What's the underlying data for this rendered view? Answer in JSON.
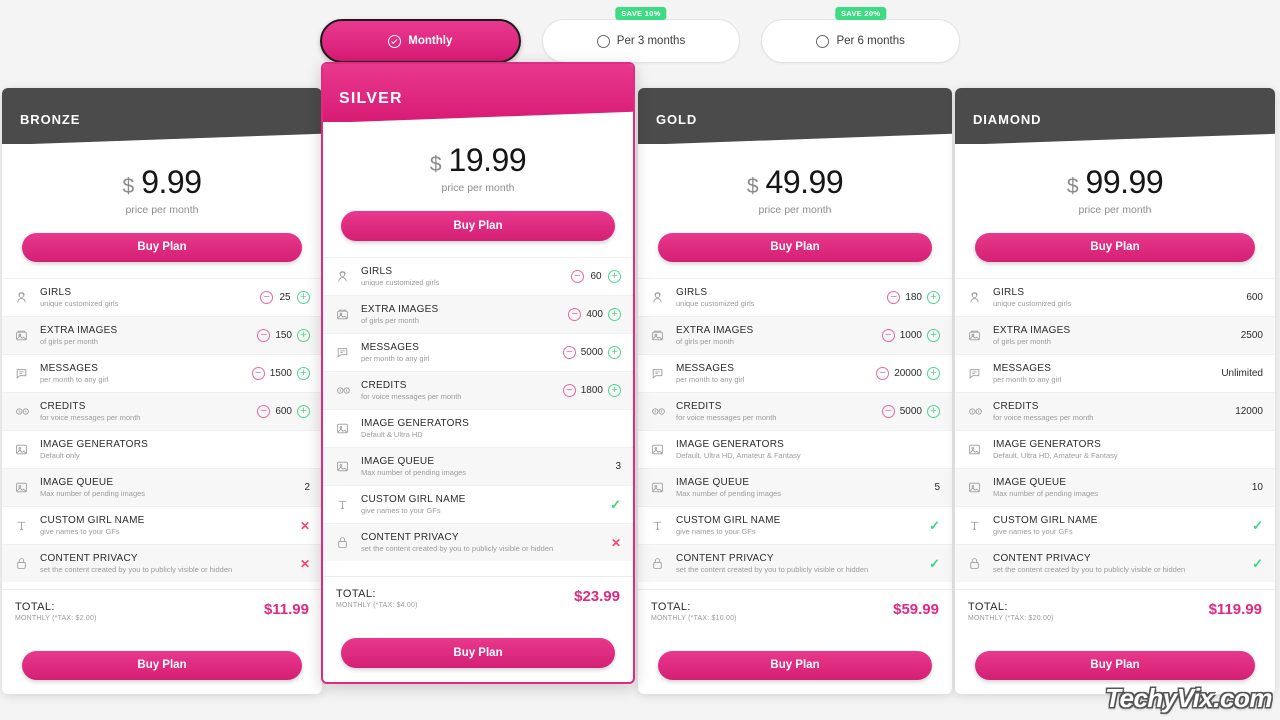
{
  "billing": {
    "options": [
      {
        "label": "Monthly",
        "selected": true,
        "badge": ""
      },
      {
        "label": "Per 3 months",
        "selected": false,
        "badge": "SAVE 10%"
      },
      {
        "label": "Per 6 months",
        "selected": false,
        "badge": "SAVE 20%"
      }
    ]
  },
  "labels": {
    "currency": "$",
    "per_month": "price per month",
    "buy": "Buy Plan",
    "total": "TOTAL:"
  },
  "feature_defs": [
    {
      "icon": "girl-avatar-icon",
      "name": "GIRLS",
      "desc": "unique customized girls"
    },
    {
      "icon": "photos-icon",
      "name": "EXTRA IMAGES",
      "desc": "of girls per month"
    },
    {
      "icon": "chat-bubble-icon",
      "name": "MESSAGES",
      "desc": "per month to any girl"
    },
    {
      "icon": "voice-credits-icon",
      "name": "CREDITS",
      "desc": "for voice messages per month"
    },
    {
      "icon": "image-generator-icon",
      "name": "IMAGE GENERATORS",
      "desc": ""
    },
    {
      "icon": "image-queue-icon",
      "name": "IMAGE QUEUE",
      "desc": "Max number of pending images"
    },
    {
      "icon": "text-cursor-icon",
      "name": "CUSTOM GIRL NAME",
      "desc": "give names to your GFs"
    },
    {
      "icon": "lock-icon",
      "name": "CONTENT PRIVACY",
      "desc": "set the content created by you to publicly visible or hidden"
    }
  ],
  "plans": [
    {
      "title": "BRONZE",
      "featured": false,
      "price": "9.99",
      "total": "$11.99",
      "total_sub": "MONTHLY (*TAX: $2.00)",
      "features": [
        {
          "type": "stepper",
          "value": "25"
        },
        {
          "type": "stepper",
          "value": "150"
        },
        {
          "type": "stepper",
          "value": "1500"
        },
        {
          "type": "stepper",
          "value": "600"
        },
        {
          "type": "none",
          "value": "",
          "desc": "Default only"
        },
        {
          "type": "plain",
          "value": "2"
        },
        {
          "type": "cross",
          "value": "✕"
        },
        {
          "type": "cross",
          "value": "✕"
        }
      ]
    },
    {
      "title": "SILVER",
      "featured": true,
      "price": "19.99",
      "total": "$23.99",
      "total_sub": "MONTHLY (*TAX: $4.00)",
      "features": [
        {
          "type": "stepper",
          "value": "60"
        },
        {
          "type": "stepper",
          "value": "400"
        },
        {
          "type": "stepper",
          "value": "5000"
        },
        {
          "type": "stepper",
          "value": "1800"
        },
        {
          "type": "none",
          "value": "",
          "desc": "Default & Ultra HD"
        },
        {
          "type": "plain",
          "value": "3"
        },
        {
          "type": "check",
          "value": "✓"
        },
        {
          "type": "cross",
          "value": "✕"
        }
      ]
    },
    {
      "title": "GOLD",
      "featured": false,
      "price": "49.99",
      "total": "$59.99",
      "total_sub": "MONTHLY (*TAX: $10.00)",
      "features": [
        {
          "type": "stepper",
          "value": "180"
        },
        {
          "type": "stepper",
          "value": "1000"
        },
        {
          "type": "stepper",
          "value": "20000"
        },
        {
          "type": "stepper",
          "value": "5000"
        },
        {
          "type": "none",
          "value": "",
          "desc": "Default, Ultra HD, Amateur & Fantasy"
        },
        {
          "type": "plain",
          "value": "5"
        },
        {
          "type": "check",
          "value": "✓"
        },
        {
          "type": "check",
          "value": "✓"
        }
      ]
    },
    {
      "title": "DIAMOND",
      "featured": false,
      "price": "99.99",
      "total": "$119.99",
      "total_sub": "MONTHLY (*TAX: $20.00)",
      "features": [
        {
          "type": "plain",
          "value": "600"
        },
        {
          "type": "plain",
          "value": "2500"
        },
        {
          "type": "plain",
          "value": "Unlimited"
        },
        {
          "type": "plain",
          "value": "12000"
        },
        {
          "type": "none",
          "value": "",
          "desc": "Default, Ultra HD, Amateur & Fantasy"
        },
        {
          "type": "plain",
          "value": "10"
        },
        {
          "type": "check",
          "value": "✓"
        },
        {
          "type": "check",
          "value": "✓"
        }
      ]
    }
  ],
  "watermark": "TechyVix.com",
  "colors": {
    "accent_pink": "#e12a82",
    "header_dark": "#4b4b4b",
    "green": "#3ddc84",
    "red": "#ef4b6e",
    "background": "#f4f4f4"
  }
}
